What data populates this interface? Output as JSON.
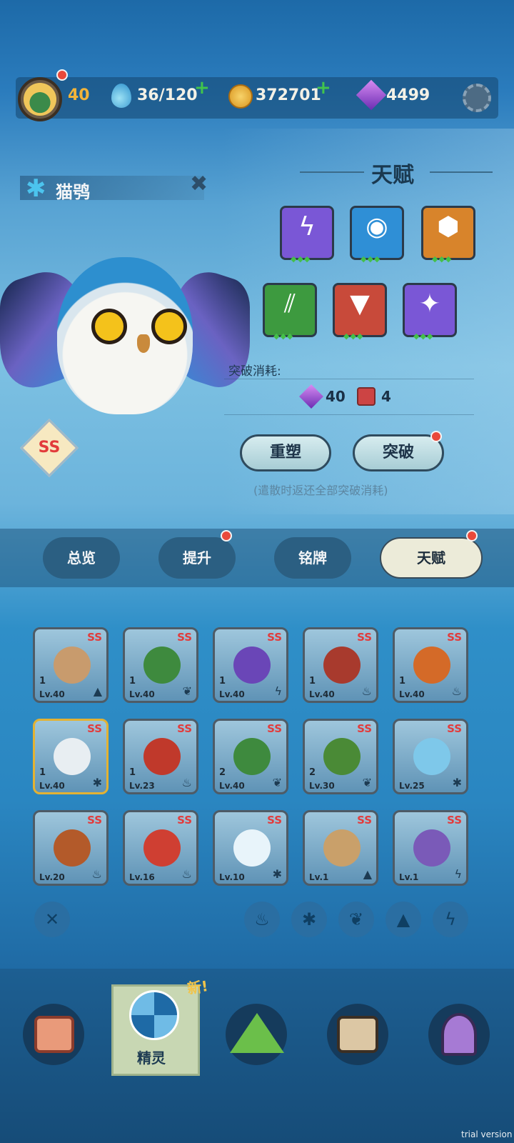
{
  "topbar": {
    "level": "40",
    "energy": "36/120",
    "coins": "372701",
    "gems": "4499",
    "energy_plus": "+",
    "coins_plus": "+"
  },
  "pet": {
    "name": "猫鸮",
    "grade": "SS"
  },
  "talent": {
    "title": "天赋",
    "icons": [
      {
        "name": "lightning",
        "color": "#7a57d6",
        "glyph": "ϟ"
      },
      {
        "name": "eye",
        "color": "#2f8fd6",
        "glyph": "◉"
      },
      {
        "name": "gem",
        "color": "#d8842b",
        "glyph": "⬢"
      },
      {
        "name": "claw",
        "color": "#3d9a3f",
        "glyph": "⫽"
      },
      {
        "name": "fangs",
        "color": "#c84a3a",
        "glyph": "▼"
      },
      {
        "name": "leaf",
        "color": "#7a57d6",
        "glyph": "✦"
      }
    ],
    "cost_label": "突破消耗:",
    "cost_gems": "40",
    "cost_items": "4",
    "reshape_label": "重塑",
    "breakthrough_label": "突破",
    "note": "(遣散时返还全部突破消耗)"
  },
  "tabs": [
    "总览",
    "提升",
    "铭牌",
    "天赋"
  ],
  "pets": [
    {
      "lv": "Lv.40",
      "star": "1",
      "el": "▲",
      "color": "#c89b6d",
      "grade": "SS"
    },
    {
      "lv": "Lv.40",
      "star": "1",
      "el": "❦",
      "color": "#3e8a3e",
      "grade": "SS"
    },
    {
      "lv": "Lv.40",
      "star": "1",
      "el": "ϟ",
      "color": "#6a46b7",
      "grade": "SS"
    },
    {
      "lv": "Lv.40",
      "star": "1",
      "el": "♨",
      "color": "#a83a2d",
      "grade": "SS"
    },
    {
      "lv": "Lv.40",
      "star": "1",
      "el": "♨",
      "color": "#d46a28",
      "grade": "SS"
    },
    {
      "lv": "Lv.40",
      "star": "1",
      "el": "✱",
      "color": "#e8eef2",
      "grade": "SS"
    },
    {
      "lv": "Lv.23",
      "star": "1",
      "el": "♨",
      "color": "#c0392b",
      "grade": "SS"
    },
    {
      "lv": "Lv.40",
      "star": "2",
      "el": "❦",
      "color": "#3e8a3e",
      "grade": "SS"
    },
    {
      "lv": "Lv.30",
      "star": "2",
      "el": "❦",
      "color": "#4a8a36",
      "grade": "SS"
    },
    {
      "lv": "Lv.25",
      "star": "",
      "el": "✱",
      "color": "#7ec8ea",
      "grade": "SS"
    },
    {
      "lv": "Lv.20",
      "star": "",
      "el": "♨",
      "color": "#b35a2a",
      "grade": "SS"
    },
    {
      "lv": "Lv.16",
      "star": "",
      "el": "♨",
      "color": "#cf3f32",
      "grade": "SS"
    },
    {
      "lv": "Lv.10",
      "star": "",
      "el": "✱",
      "color": "#e8f4fa",
      "grade": "SS"
    },
    {
      "lv": "Lv.1",
      "star": "",
      "el": "▲",
      "color": "#c9a06a",
      "grade": "SS"
    },
    {
      "lv": "Lv.1",
      "star": "",
      "el": "ϟ",
      "color": "#7a5ab8",
      "grade": "SS"
    }
  ],
  "filters": [
    "✕",
    "♨",
    "✱",
    "❦",
    "▲",
    "ϟ"
  ],
  "nav": {
    "active_label": "精灵",
    "new_badge": "新!"
  },
  "watermark": "trial version"
}
